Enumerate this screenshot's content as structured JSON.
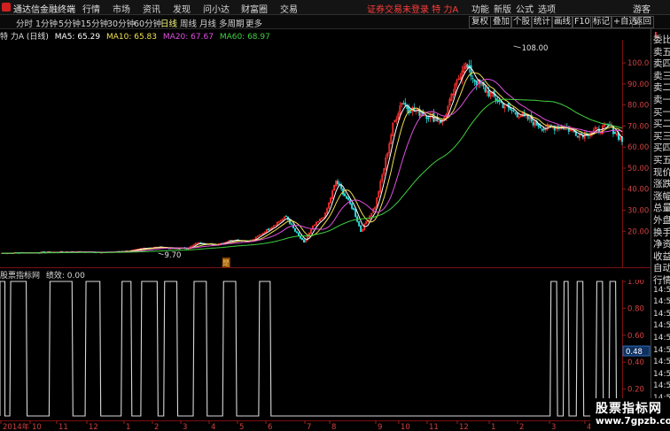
{
  "menubar": {
    "app_name": "通达信金融终端",
    "items": [
      "行情",
      "市场",
      "资讯",
      "发现",
      "问小达",
      "财富圈",
      "交易"
    ],
    "alert": "证券交易未登录  特 力A",
    "right_items": [
      "功能",
      "新版",
      "公式",
      "选项"
    ],
    "guest": "游客"
  },
  "periodbar": {
    "periods": [
      "分时",
      "1分钟",
      "5分钟",
      "15分钟",
      "30分钟",
      "60分钟",
      "日线",
      "周线",
      "月线",
      "多周期",
      "更多"
    ],
    "active": "日线",
    "tools": [
      "复权",
      "叠加",
      "个股",
      "统计",
      "画线",
      "F10",
      "标记",
      "+自选",
      "返回"
    ]
  },
  "legend": {
    "stock": "特 力A (日线)",
    "ma": [
      {
        "label": "MA5: 65.29",
        "color": "#ffffff"
      },
      {
        "label": "MA10: 65.83",
        "color": "#f0e050"
      },
      {
        "label": "MA20: 67.67",
        "color": "#e050e0"
      },
      {
        "label": "MA60: 68.97",
        "color": "#40d040"
      }
    ]
  },
  "price_axis": {
    "ticks": [
      "100.0",
      "90.00",
      "80.00",
      "70.00",
      "60.00",
      "50.00",
      "40.00",
      "30.00",
      "20.00"
    ],
    "high_label": "108.00",
    "low_label": "9.70",
    "marker": "是"
  },
  "indicator": {
    "title": "股票指标网",
    "value_label": "绩效: 0.00",
    "ticks": [
      "1.00",
      "0.80",
      "0.60",
      "0.40",
      "0.20"
    ],
    "current": "0.48"
  },
  "time_axis": {
    "labels": [
      "2014年",
      "10",
      "11",
      "12",
      "1",
      "2",
      "3",
      "4",
      "5",
      "6",
      "7",
      "8",
      "9",
      "10",
      "11",
      "12",
      "1",
      "2",
      "3",
      "4"
    ]
  },
  "right_panel": {
    "badge": "L",
    "items": [
      "委比",
      "卖五",
      "卖四",
      "卖三",
      "卖二",
      "卖一",
      "买一",
      "买二",
      "买三",
      "买四",
      "买五",
      "现价",
      "涨跌",
      "涨幅",
      "总量",
      "外盘",
      "换手",
      "净资",
      "收益",
      "自动",
      "行情",
      "14:5",
      "14:5",
      "14:5",
      "14:5",
      "14:5",
      "14:5",
      "14:5",
      "14:5",
      "14:5",
      "14:5",
      "14:5"
    ]
  },
  "watermark": {
    "line1": "股票指标网",
    "line2": "www.7gpzb.com"
  },
  "colors": {
    "up": "#ff3030",
    "down": "#2fd8d8",
    "ma5": "#ffffff",
    "ma10": "#f0e050",
    "ma20": "#e050e0",
    "ma60": "#40d040"
  }
}
